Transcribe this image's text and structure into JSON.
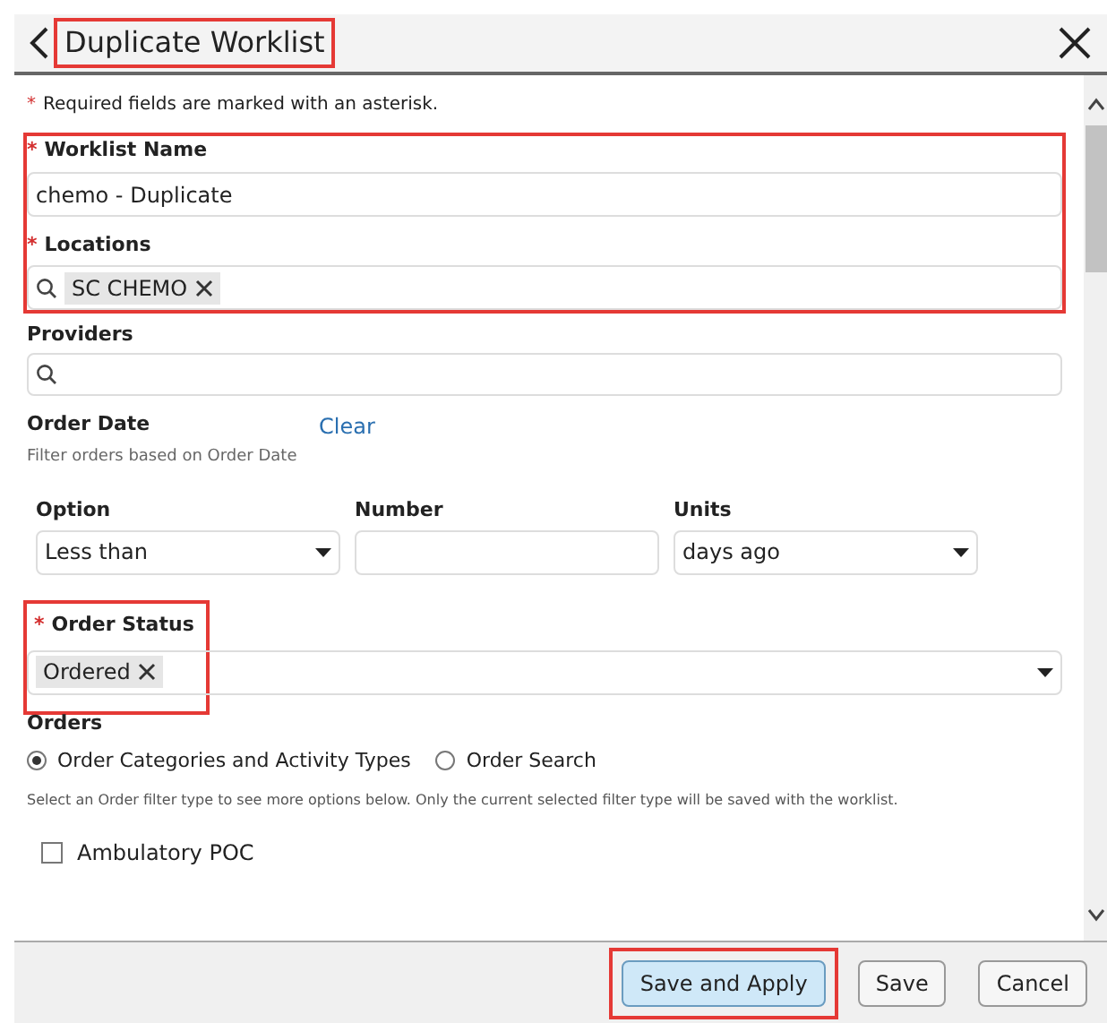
{
  "header": {
    "title": "Duplicate Worklist",
    "title_highlighted": true
  },
  "required_note": "Required fields are marked with an asterisk.",
  "required_mark": "*",
  "name_locations_highlighted": true,
  "worklist_name": {
    "label": "Worklist Name",
    "required": true,
    "value": "chemo - Duplicate"
  },
  "locations": {
    "label": "Locations",
    "required": true,
    "tags": [
      "SC CHEMO"
    ]
  },
  "providers": {
    "label": "Providers",
    "required": false
  },
  "order_date": {
    "label": "Order Date",
    "clear": "Clear",
    "help": "Filter orders based on Order Date",
    "option": {
      "label": "Option",
      "value": "Less than"
    },
    "number": {
      "label": "Number"
    },
    "units": {
      "label": "Units",
      "value": "days ago"
    }
  },
  "order_status": {
    "label": "Order Status",
    "required": true,
    "highlighted": true,
    "tags": [
      "Ordered"
    ]
  },
  "orders": {
    "label": "Orders",
    "radios": [
      {
        "label": "Order Categories and Activity Types",
        "selected": true
      },
      {
        "label": "Order Search",
        "selected": false
      }
    ],
    "note": "Select an Order filter type to see more options below. Only the current selected filter type will be saved with the worklist.",
    "checkboxes": [
      {
        "label": "Ambulatory POC",
        "checked": false
      }
    ]
  },
  "buttons": [
    {
      "label": "Save and Apply",
      "primary": true,
      "highlighted": true
    },
    {
      "label": "Save",
      "primary": false,
      "highlighted": false
    },
    {
      "label": "Cancel",
      "primary": false,
      "highlighted": false
    }
  ]
}
